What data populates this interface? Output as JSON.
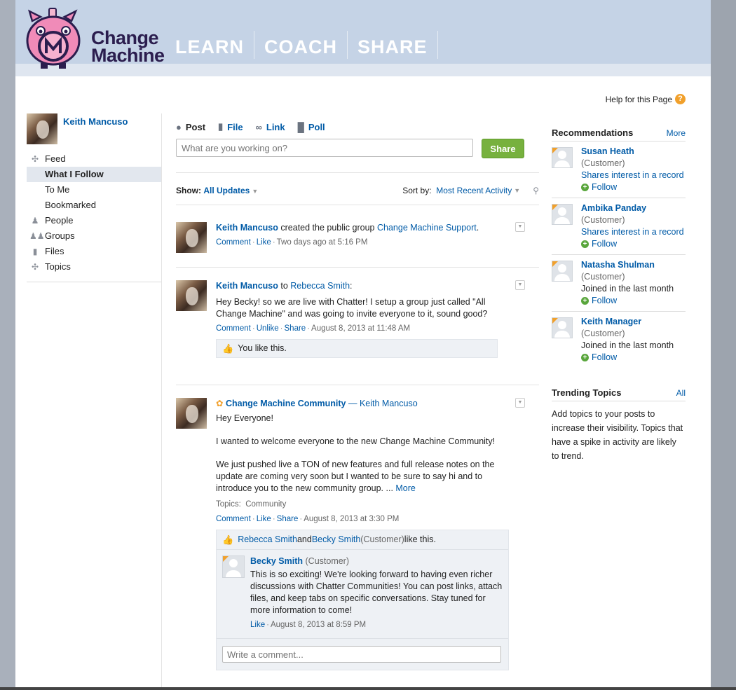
{
  "brand": {
    "line1": "Change",
    "line2": "Machine",
    "logo_letter": "M"
  },
  "topnav": [
    "LEARN",
    "COACH",
    "SHARE"
  ],
  "help": {
    "label": "Help for this Page",
    "icon": "question-icon"
  },
  "sidebar": {
    "user": "Keith Mancuso",
    "items": [
      {
        "label": "Feed",
        "icon": "feed-icon"
      },
      {
        "label": "What I Follow",
        "active": true
      },
      {
        "label": "To Me"
      },
      {
        "label": "Bookmarked"
      },
      {
        "label": "People",
        "icon": "person-icon"
      },
      {
        "label": "Groups",
        "icon": "groups-icon"
      },
      {
        "label": "Files",
        "icon": "file-icon"
      },
      {
        "label": "Topics",
        "icon": "topics-icon"
      }
    ]
  },
  "publisher": {
    "tabs": [
      {
        "label": "Post",
        "icon": "speech-bubble-icon"
      },
      {
        "label": "File",
        "icon": "file-icon"
      },
      {
        "label": "Link",
        "icon": "link-icon"
      },
      {
        "label": "Poll",
        "icon": "poll-icon"
      }
    ],
    "placeholder": "What are you working on?",
    "share_label": "Share"
  },
  "filter": {
    "show_label": "Show:",
    "show_value": "All Updates",
    "sort_label": "Sort by:",
    "sort_value": "Most Recent Activity"
  },
  "posts": [
    {
      "author": "Keith Mancuso",
      "text_mid": " created the public group ",
      "target": "Change Machine Support",
      "text_end": ".",
      "actions": [
        "Comment",
        "Like"
      ],
      "time": "Two days ago at 5:16 PM"
    },
    {
      "author": "Keith Mancuso",
      "text_mid": " to ",
      "target": "Rebecca Smith",
      "text_end": ":",
      "body": "Hey Becky! so we are live with Chatter! I setup a group just called \"All Change Machine\" and was going to invite everyone to it, sound good?",
      "actions": [
        "Comment",
        "Unlike",
        "Share"
      ],
      "time": "August 8, 2013 at 11:48 AM",
      "likes": "You like this."
    },
    {
      "group": "Change Machine Community",
      "dash": " — ",
      "author": "Keith Mancuso",
      "p1": "Hey Everyone!",
      "p2": "I wanted to welcome everyone to the new Change Machine Community!",
      "p3": "We just pushed live a TON of new features and full release notes on the update are coming very soon but I wanted to be sure to say hi and to introduce you to the new community group. ... ",
      "more": "More",
      "topics_label": "Topics:",
      "topics_value": "Community",
      "actions": [
        "Comment",
        "Like",
        "Share"
      ],
      "time": "August 8, 2013 at 3:30 PM",
      "likers": {
        "a": "Rebecca Smith",
        "and": " and ",
        "b": "Becky Smith",
        "b_role": " (Customer)",
        "end": " like this."
      },
      "comment": {
        "author": "Becky Smith",
        "role": " (Customer)",
        "text": "This is so exciting! We're looking forward to having even richer discussions with Chatter Communities! You can post links, attach files, and keep tabs on specific conversations. Stay tuned for more information to come!",
        "action": "Like",
        "time": "August 8, 2013 at 8:59 PM"
      },
      "comment_placeholder": "Write a comment..."
    }
  ],
  "recommendations": {
    "title": "Recommendations",
    "more": "More",
    "follow_label": "Follow",
    "items": [
      {
        "name": "Susan Heath",
        "role": "(Customer)",
        "reason": "Shares interest in a record"
      },
      {
        "name": "Ambika Panday",
        "role": "(Customer)",
        "reason": "Shares interest in a record"
      },
      {
        "name": "Natasha Shulman",
        "role": "(Customer)",
        "reason": "Joined in the last month"
      },
      {
        "name": "Keith Manager",
        "role": "(Customer)",
        "reason": "Joined in the last month"
      }
    ]
  },
  "trending": {
    "title": "Trending Topics",
    "all": "All",
    "text": "Add topics to your posts to increase their visibility. Topics that have a spike in activity are likely to trend."
  },
  "colors": {
    "header": "#c5d3e6",
    "link": "#015ba7",
    "share_button": "#77b13e",
    "pig": "#f08bb8"
  }
}
